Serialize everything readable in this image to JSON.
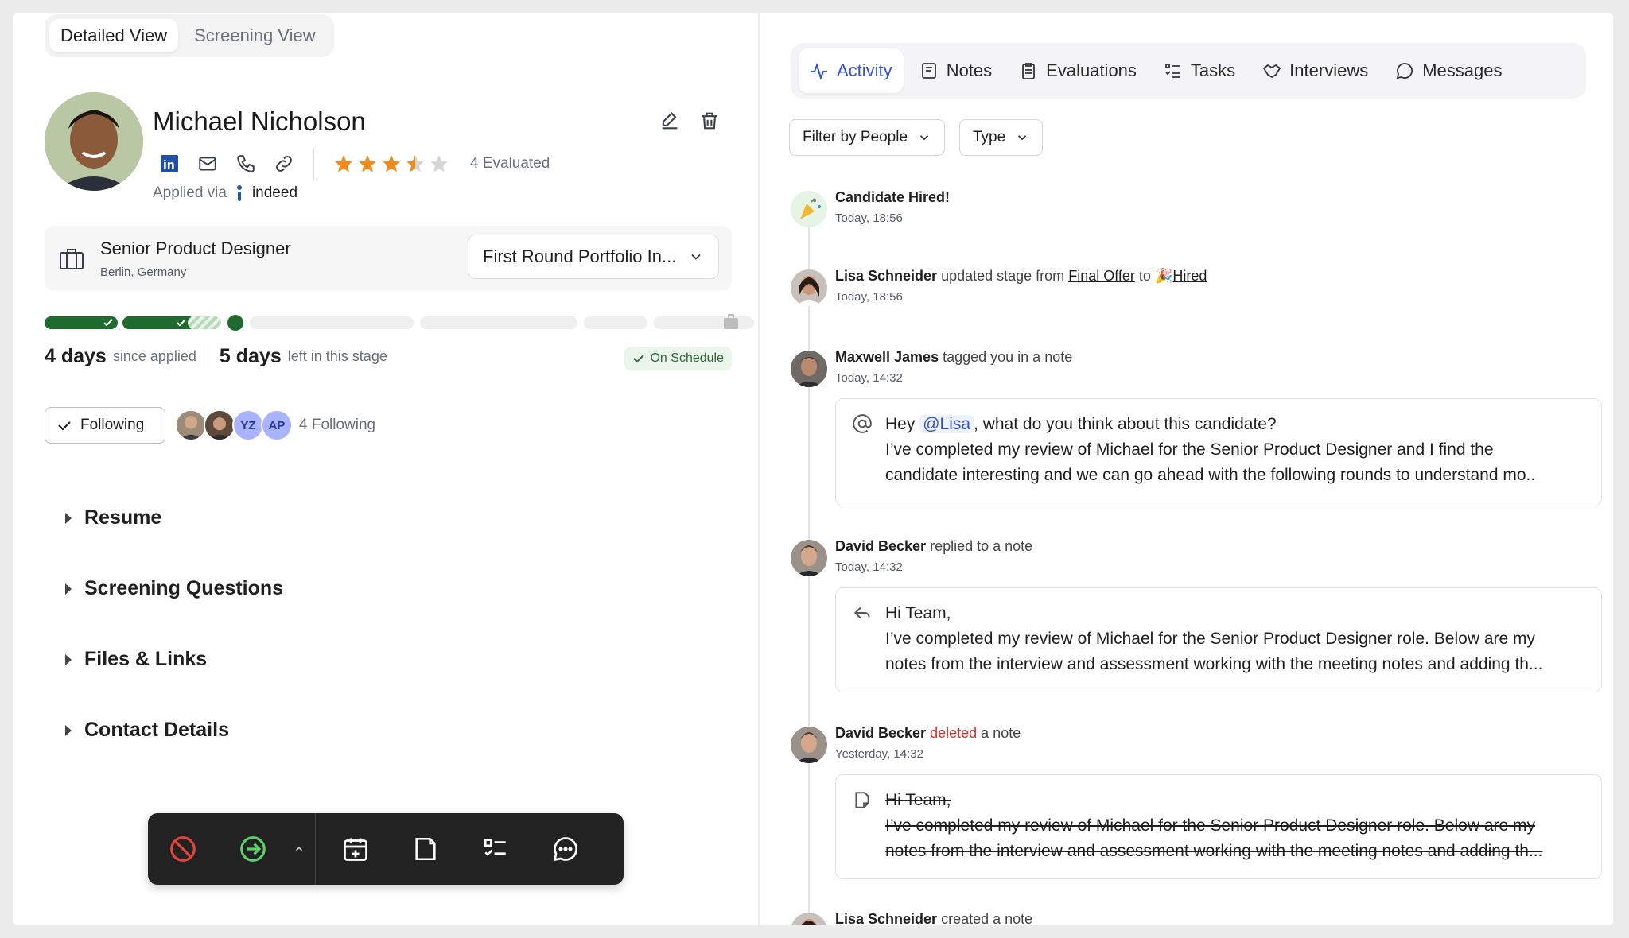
{
  "view_tabs": {
    "detailed": "Detailed View",
    "screening": "Screening View"
  },
  "candidate": {
    "name": "Michael Nicholson",
    "evaluated": "4 Evaluated",
    "rating": 3.5,
    "applied_label": "Applied via",
    "source": "indeed"
  },
  "job": {
    "title": "Senior Product Designer",
    "location": "Berlin, Germany",
    "stage": "First Round Portfolio In..."
  },
  "progress": {
    "days_applied": "4 days",
    "since_applied": "since applied",
    "days_left": "5 days",
    "left_label": "left in this stage",
    "status": "On Schedule"
  },
  "following": {
    "button": "Following",
    "initials": [
      "YZ",
      "AP"
    ],
    "count": "4 Following"
  },
  "sections": [
    "Resume",
    "Screening Questions",
    "Files & Links",
    "Contact Details"
  ],
  "right_tabs": [
    "Activity",
    "Notes",
    "Evaluations",
    "Tasks",
    "Interviews",
    "Messages"
  ],
  "filters": {
    "people": "Filter by People",
    "type": "Type"
  },
  "activity": {
    "a1": {
      "title": "Candidate Hired!",
      "time": "Today, 18:56"
    },
    "a2": {
      "name": "Lisa Schneider",
      "text1": "updated stage from",
      "from": "Final Offer",
      "to_word": "to",
      "to": "Hired",
      "time": "Today, 18:56"
    },
    "a3": {
      "name": "Maxwell James",
      "text": "tagged you in a note",
      "time": "Today, 14:32",
      "note_pre": "Hey",
      "mention": "@Lisa",
      "note_post": ", what do you think about this candidate?",
      "line2": "I’ve completed my review of  Michael for the Senior Product Designer and I find the",
      "line3": "candidate interesting and we can go ahead with the following rounds to understand mo.."
    },
    "a4": {
      "name": "David Becker",
      "text": "replied to a note",
      "time": "Today, 14:32",
      "line1": "Hi Team,",
      "line2": "I’ve completed my review of Michael for the Senior Product Designer role. Below are my",
      "line3": "notes from the interview and assessment working with the meeting notes and adding th..."
    },
    "a5": {
      "name": "David Becker",
      "deleted": "deleted",
      "text": "a note",
      "time": "Yesterday, 14:32",
      "line1": "Hi Team,",
      "line2": "I’ve completed my review of Michael for the Senior Product Designer role. Below are my",
      "line3": "notes from the interview and assessment working with the meeting notes and adding th..."
    },
    "a6": {
      "name": "Lisa Schneider",
      "text": "created a note"
    }
  },
  "colors": {
    "accent": "#3152d4",
    "progress_done": "#1f6b2f",
    "star": "#f08a1c",
    "deleted": "#d0302b",
    "toolbar": "#222222"
  }
}
